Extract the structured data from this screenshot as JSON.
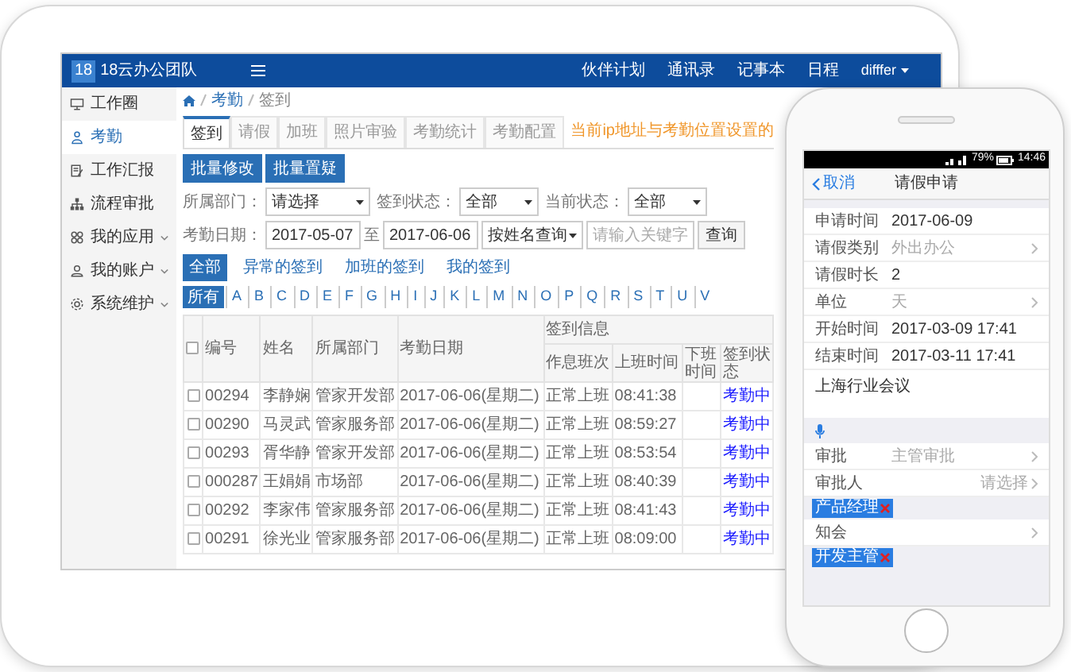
{
  "header": {
    "logo_mark": "18",
    "brand": "18云办公团队",
    "links": [
      "伙伴计划",
      "通讯录",
      "记事本",
      "日程"
    ],
    "user": "difffer"
  },
  "sidebar": {
    "items": [
      {
        "label": "工作圈",
        "selected": false,
        "has_submenu": false
      },
      {
        "label": "考勤",
        "selected": true,
        "has_submenu": false
      },
      {
        "label": "工作汇报",
        "selected": false,
        "has_submenu": false
      },
      {
        "label": "流程审批",
        "selected": false,
        "has_submenu": false
      },
      {
        "label": "我的应用",
        "selected": false,
        "has_submenu": true
      },
      {
        "label": "我的账户",
        "selected": false,
        "has_submenu": true
      },
      {
        "label": "系统维护",
        "selected": false,
        "has_submenu": true
      }
    ]
  },
  "breadcrumb": [
    "考勤",
    "签到"
  ],
  "tabs": [
    {
      "label": "签到",
      "selected": true
    },
    {
      "label": "请假",
      "selected": false
    },
    {
      "label": "加班",
      "selected": false
    },
    {
      "label": "照片审验",
      "selected": false
    },
    {
      "label": "考勤统计",
      "selected": false
    },
    {
      "label": "考勤配置",
      "selected": false
    }
  ],
  "notice": "当前ip地址与考勤位置设置的",
  "action_buttons": [
    "批量修改",
    "批量置疑"
  ],
  "filters": [
    {
      "label": "所属部门：",
      "value": "请选择"
    },
    {
      "label": "签到状态：",
      "value": "全部"
    },
    {
      "label": "当前状态：",
      "value": "全部"
    }
  ],
  "date_filter": {
    "label": "考勤日期：",
    "from": "2017-05-07",
    "separator": "至",
    "to": "2017-06-06"
  },
  "search": {
    "mode": "按姓名查询",
    "placeholder": "请输入关键字",
    "button": "查询"
  },
  "quick_filters": [
    {
      "label": "全部",
      "selected": true
    },
    {
      "label": "异常的签到",
      "selected": false
    },
    {
      "label": "加班的签到",
      "selected": false
    },
    {
      "label": "我的签到",
      "selected": false
    }
  ],
  "letters": [
    {
      "label": "所有",
      "selected": true
    },
    {
      "label": "A",
      "selected": false
    },
    {
      "label": "B",
      "selected": false
    },
    {
      "label": "C",
      "selected": false
    },
    {
      "label": "D",
      "selected": false
    },
    {
      "label": "E",
      "selected": false
    },
    {
      "label": "F",
      "selected": false
    },
    {
      "label": "G",
      "selected": false
    },
    {
      "label": "H",
      "selected": false
    },
    {
      "label": "I",
      "selected": false
    },
    {
      "label": "J",
      "selected": false
    },
    {
      "label": "K",
      "selected": false
    },
    {
      "label": "L",
      "selected": false
    },
    {
      "label": "M",
      "selected": false
    },
    {
      "label": "N",
      "selected": false
    },
    {
      "label": "O",
      "selected": false
    },
    {
      "label": "P",
      "selected": false
    },
    {
      "label": "Q",
      "selected": false
    },
    {
      "label": "R",
      "selected": false
    },
    {
      "label": "S",
      "selected": false
    },
    {
      "label": "T",
      "selected": false
    },
    {
      "label": "U",
      "selected": false
    },
    {
      "label": "V",
      "selected": false
    }
  ],
  "table": {
    "all_checked": false,
    "columns": [
      "编号",
      "姓名",
      "所属部门",
      "考勤日期"
    ],
    "group_header": "签到信息",
    "sub_columns": [
      "作息班次",
      "上班时间",
      "下班时间",
      "签到状态"
    ],
    "rows": [
      {
        "checked": false,
        "id": "00294",
        "name": "李静娴",
        "dept": "管家开发部",
        "date": "2017-06-06(星期二)",
        "shift": "正常上班",
        "clock_in": "08:41:38",
        "status": "考勤中"
      },
      {
        "checked": false,
        "id": "00290",
        "name": "马灵武",
        "dept": "管家服务部",
        "date": "2017-06-06(星期二)",
        "shift": "正常上班",
        "clock_in": "08:59:27",
        "status": "考勤中"
      },
      {
        "checked": false,
        "id": "00293",
        "name": "胥华静",
        "dept": "管家开发部",
        "date": "2017-06-06(星期二)",
        "shift": "正常上班",
        "clock_in": "08:53:54",
        "status": "考勤中"
      },
      {
        "checked": false,
        "id": "000287",
        "name": "王娟娟",
        "dept": "市场部",
        "date": "2017-06-06(星期二)",
        "shift": "正常上班",
        "clock_in": "08:40:39",
        "status": "考勤中"
      },
      {
        "checked": false,
        "id": "00292",
        "name": "李家伟",
        "dept": "管家服务部",
        "date": "2017-06-06(星期二)",
        "shift": "正常上班",
        "clock_in": "08:41:43",
        "status": "考勤中"
      },
      {
        "checked": false,
        "id": "00291",
        "name": "徐光业",
        "dept": "管家服务部",
        "date": "2017-06-06(星期二)",
        "shift": "正常上班",
        "clock_in": "08:09:00",
        "status": "考勤中"
      }
    ]
  },
  "phone": {
    "status_bar": {
      "battery": "79%",
      "time": "14:46"
    },
    "nav": {
      "back": "取消",
      "title": "请假申请"
    },
    "fields": [
      {
        "label": "申请时间",
        "value": "2017-06-09",
        "kind": "text"
      },
      {
        "label": "请假类别",
        "value": "外出办公",
        "kind": "select"
      },
      {
        "label": "请假时长",
        "value": "2",
        "kind": "text"
      },
      {
        "label": "单位",
        "value": "天",
        "kind": "select"
      },
      {
        "label": "开始时间",
        "value": "2017-03-09 17:41",
        "kind": "text"
      },
      {
        "label": "结束时间",
        "value": "2017-03-11 17:41",
        "kind": "text"
      }
    ],
    "reason": "上海行业会议",
    "approvals": [
      {
        "label": "审批",
        "value": "主管审批",
        "kind": "select"
      },
      {
        "label": "审批人",
        "value": "请选择",
        "kind": "picker",
        "tags": [
          "产品经理"
        ]
      },
      {
        "label": "知会",
        "kind": "picker",
        "tags": [
          "开发主管"
        ]
      }
    ]
  }
}
